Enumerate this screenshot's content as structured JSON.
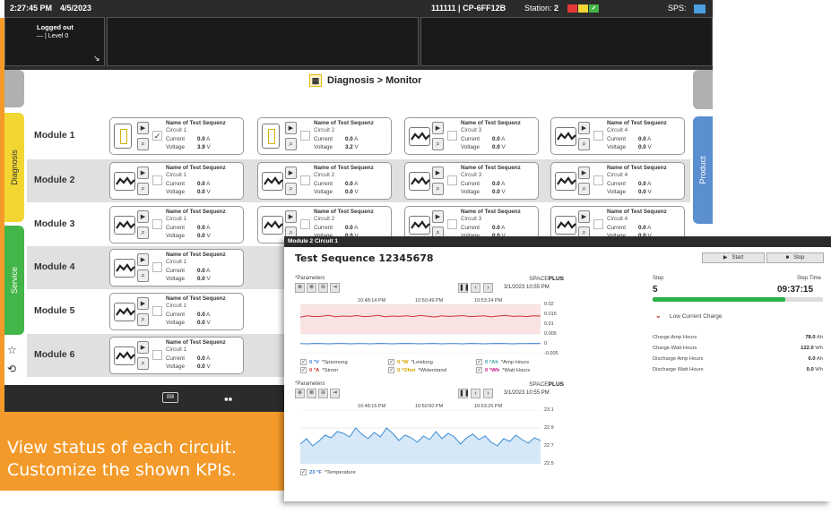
{
  "colors": {
    "accent": "#f39a2a",
    "status_red": "#e53935",
    "status_yellow": "#f2d733",
    "status_green": "#44b548",
    "sps_blue": "#4aa0e0",
    "diagnosis_tab": "#f2d733",
    "service_tab": "#44b548",
    "product_tab": "#5b8fcf"
  },
  "topbar": {
    "time": "2:27:45 PM",
    "date": "4/5/2023",
    "device": "111111 | CP-6FF12B",
    "station_label": "Station:",
    "station_num": "2",
    "sps_label": "SPS:"
  },
  "login": {
    "status": "Logged out",
    "level": "— | Level 0"
  },
  "breadcrumb": "Diagnosis > Monitor",
  "side_tabs": {
    "diagnosis": "Diagnosis",
    "service": "Service",
    "product": "Product"
  },
  "modules": [
    {
      "label": "Module 1",
      "circuits": [
        {
          "icon": "battery-icon",
          "checked": true,
          "name": "Name of Test Sequenz",
          "circuit": "Circuit 1",
          "current": "0.0",
          "current_unit": "A",
          "voltage": "3.9",
          "voltage_unit": "V"
        },
        {
          "icon": "battery-icon",
          "checked": false,
          "name": "Name of Test Sequenz",
          "circuit": "Circuit 2",
          "current": "0.0",
          "current_unit": "A",
          "voltage": "3.2",
          "voltage_unit": "V"
        },
        {
          "icon": "waveform-icon",
          "checked": false,
          "name": "Name of Test Sequenz",
          "circuit": "Circuit 3",
          "current": "0.0",
          "current_unit": "A",
          "voltage": "0.0",
          "voltage_unit": "V"
        },
        {
          "icon": "waveform-icon",
          "checked": false,
          "name": "Name of Test Sequenz",
          "circuit": "Circuit 4",
          "current": "0.0",
          "current_unit": "A",
          "voltage": "0.0",
          "voltage_unit": "V"
        }
      ]
    },
    {
      "label": "Module 2",
      "circuits": [
        {
          "icon": "waveform-icon",
          "checked": false,
          "name": "Name of Test Sequenz",
          "circuit": "Circuit 1",
          "current": "0.0",
          "current_unit": "A",
          "voltage": "0.0",
          "voltage_unit": "V"
        },
        {
          "icon": "waveform-icon",
          "checked": false,
          "name": "Name of Test Sequenz",
          "circuit": "Circuit 2",
          "current": "0.0",
          "current_unit": "A",
          "voltage": "0.0",
          "voltage_unit": "V"
        },
        {
          "icon": "waveform-icon",
          "checked": false,
          "name": "Name of Test Sequenz",
          "circuit": "Circuit 3",
          "current": "0.0",
          "current_unit": "A",
          "voltage": "0.0",
          "voltage_unit": "V"
        },
        {
          "icon": "waveform-icon",
          "checked": false,
          "name": "Name of Test Sequenz",
          "circuit": "Circuit 4",
          "current": "0.0",
          "current_unit": "A",
          "voltage": "0.0",
          "voltage_unit": "V"
        }
      ]
    },
    {
      "label": "Module 3",
      "circuits": [
        {
          "icon": "waveform-icon",
          "checked": false,
          "name": "Name of Test Sequenz",
          "circuit": "Circuit 1",
          "current": "0.0",
          "current_unit": "A",
          "voltage": "0.0",
          "voltage_unit": "V"
        },
        {
          "icon": "waveform-icon",
          "checked": false,
          "name": "Name of Test Sequenz",
          "circuit": "Circuit 2",
          "current": "0.0",
          "current_unit": "A",
          "voltage": "0.0",
          "voltage_unit": "V"
        },
        {
          "icon": "waveform-icon",
          "checked": false,
          "name": "Name of Test Sequenz",
          "circuit": "Circuit 3",
          "current": "0.0",
          "current_unit": "A",
          "voltage": "0.0",
          "voltage_unit": "V"
        },
        {
          "icon": "waveform-icon",
          "checked": false,
          "name": "Name of Test Sequenz",
          "circuit": "Circuit 4",
          "current": "0.0",
          "current_unit": "A",
          "voltage": "0.0",
          "voltage_unit": "V"
        }
      ]
    },
    {
      "label": "Module 4",
      "circuits": [
        {
          "icon": "waveform-icon",
          "checked": false,
          "name": "Name of Test Sequenz",
          "circuit": "Circuit 1",
          "current": "0.0",
          "current_unit": "A",
          "voltage": "0.0",
          "voltage_unit": "V"
        }
      ]
    },
    {
      "label": "Module 5",
      "circuits": [
        {
          "icon": "waveform-icon",
          "checked": false,
          "name": "Name of Test Sequenz",
          "circuit": "Circuit 1",
          "current": "0.0",
          "current_unit": "A",
          "voltage": "0.0",
          "voltage_unit": "V"
        }
      ]
    },
    {
      "label": "Module 6",
      "circuits": [
        {
          "icon": "waveform-icon",
          "checked": false,
          "name": "Name of Test Sequenz",
          "circuit": "Circuit 1",
          "current": "0.0",
          "current_unit": "A",
          "voltage": "0.0",
          "voltage_unit": "V"
        }
      ]
    }
  ],
  "labels": {
    "current": "Current",
    "voltage": "Voltage"
  },
  "module4_partial": [
    "Name of Test Sequenz",
    "Name of Test Sequenz",
    "Name of Test Sequenz"
  ],
  "overlay": {
    "bar_title": "Module 2 Circuit 1",
    "title": "Test Sequence  12345678",
    "start": "Start",
    "stop": "Stop",
    "step_label": "Step",
    "step_value": "5",
    "step_time_label": "Step Time",
    "step_time_value": "09:37:15",
    "progress": 0.78,
    "alarm": "Low Current Charge",
    "kpis": [
      {
        "label": "Charge Amp Hours",
        "value": "78.0",
        "unit": "Ah"
      },
      {
        "label": "Charge Watt Hours",
        "value": "122.0",
        "unit": "Wh"
      },
      {
        "label": "Discharge Amp Hours",
        "value": "0.0",
        "unit": "Ah"
      },
      {
        "label": "Discharge Watt Hours",
        "value": "0.0",
        "unit": "Wh"
      }
    ]
  },
  "chart_data": [
    {
      "type": "line",
      "params_label": "*Parameters",
      "brand": "SPACE",
      "brand_bold": "PLUS",
      "date": "3/1/2023  10:55 PM",
      "x_ticks": [
        "10:48:14 PM",
        "10:50:49 PM",
        "10:53:24 PM"
      ],
      "y_ticks": [
        "0.02",
        "0.015",
        "0.01",
        "0.005",
        "0",
        "-0.005"
      ],
      "ylim": [
        -0.005,
        0.02
      ],
      "series": [
        {
          "name": "*Spannung",
          "color": "#d23030",
          "values": [
            0.0135,
            0.0142,
            0.0138,
            0.014,
            0.0144,
            0.0137,
            0.0141,
            0.0139,
            0.0143,
            0.0138,
            0.014,
            0.0145,
            0.0137,
            0.0141,
            0.0139,
            0.0142,
            0.0138,
            0.0144,
            0.014,
            0.0136,
            0.0142,
            0.0139,
            0.0141,
            0.0143,
            0.0138,
            0.014,
            0.0142,
            0.0137,
            0.0141,
            0.0144,
            0.0139,
            0.0141,
            0.0138,
            0.0142,
            0.0141
          ]
        },
        {
          "name": "*Strom",
          "color": "#3a7bd5",
          "values": [
            0.0001,
            0.0,
            0.0002,
            0.0001,
            0.0,
            0.0001,
            0.0002,
            0.0,
            0.0001,
            0.0001,
            0.0,
            0.0002,
            0.0001,
            0.0,
            0.0001,
            0.0002,
            0.0001,
            0.0,
            0.0001,
            0.0002,
            0.0,
            0.0001,
            0.0001,
            0.0,
            0.0002,
            0.0001,
            0.0,
            0.0001,
            0.0002,
            0.0001,
            0.0,
            0.0001,
            0.0001,
            0.0002,
            0.0001
          ]
        }
      ],
      "legend": [
        {
          "value": "0",
          "unit": "°V",
          "name": "*Spannung",
          "color": "#3a7bd5"
        },
        {
          "value": "0",
          "unit": "°W",
          "name": "*Leistung",
          "color": "#d4a300"
        },
        {
          "value": "0",
          "unit": "°Ah",
          "name": "*Amp Hours",
          "color": "#3aa5a5"
        },
        {
          "value": "0",
          "unit": "°A",
          "name": "*Strom",
          "color": "#d23030"
        },
        {
          "value": "0",
          "unit": "°Ohm",
          "name": "*Widerstand",
          "color": "#d4a300"
        },
        {
          "value": "0",
          "unit": "°Wh",
          "name": "*Watt Hours",
          "color": "#c2188b"
        }
      ]
    },
    {
      "type": "area",
      "params_label": "*Parameters",
      "brand": "SPACE",
      "brand_bold": "PLUS",
      "date": "3/1/2023  10:55 PM",
      "x_ticks": [
        "10:48:15 PM",
        "10:50:50 PM",
        "10:53:25 PM"
      ],
      "y_ticks": [
        "23.1",
        "22.9",
        "22.7",
        "22.5"
      ],
      "ylim": [
        22.5,
        23.1
      ],
      "series": [
        {
          "name": "*Temperature",
          "color": "#3a8ad5",
          "values": [
            22.72,
            22.78,
            22.7,
            22.75,
            22.82,
            22.79,
            22.86,
            22.84,
            22.8,
            22.9,
            22.83,
            22.78,
            22.85,
            22.8,
            22.9,
            22.84,
            22.76,
            22.82,
            22.79,
            22.74,
            22.81,
            22.77,
            22.86,
            22.78,
            22.84,
            22.8,
            22.72,
            22.79,
            22.83,
            22.77,
            22.81,
            22.74,
            22.7,
            22.78,
            22.75,
            22.82,
            22.77,
            22.73,
            22.79,
            22.76
          ]
        }
      ],
      "legend": [
        {
          "value": "23",
          "unit": "°F",
          "name": "*Temperature",
          "color": "#3a7bd5"
        }
      ]
    }
  ],
  "marketing": {
    "line1": "View status of each circuit.",
    "line2": "Customize the shown KPIs."
  }
}
